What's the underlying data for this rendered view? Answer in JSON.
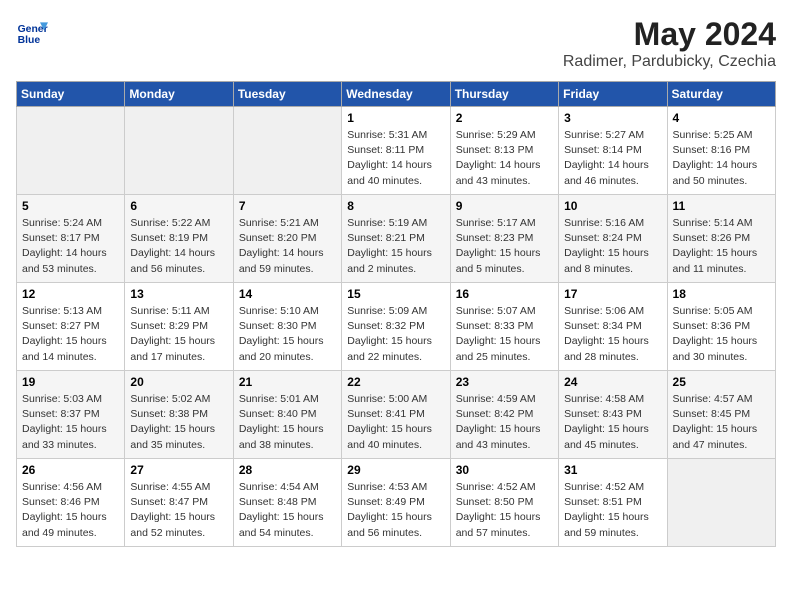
{
  "logo": {
    "line1": "General",
    "line2": "Blue"
  },
  "title": "May 2024",
  "subtitle": "Radimer, Pardubicky, Czechia",
  "headers": [
    "Sunday",
    "Monday",
    "Tuesday",
    "Wednesday",
    "Thursday",
    "Friday",
    "Saturday"
  ],
  "weeks": [
    [
      {
        "day": "",
        "info": ""
      },
      {
        "day": "",
        "info": ""
      },
      {
        "day": "",
        "info": ""
      },
      {
        "day": "1",
        "info": "Sunrise: 5:31 AM\nSunset: 8:11 PM\nDaylight: 14 hours\nand 40 minutes."
      },
      {
        "day": "2",
        "info": "Sunrise: 5:29 AM\nSunset: 8:13 PM\nDaylight: 14 hours\nand 43 minutes."
      },
      {
        "day": "3",
        "info": "Sunrise: 5:27 AM\nSunset: 8:14 PM\nDaylight: 14 hours\nand 46 minutes."
      },
      {
        "day": "4",
        "info": "Sunrise: 5:25 AM\nSunset: 8:16 PM\nDaylight: 14 hours\nand 50 minutes."
      }
    ],
    [
      {
        "day": "5",
        "info": "Sunrise: 5:24 AM\nSunset: 8:17 PM\nDaylight: 14 hours\nand 53 minutes."
      },
      {
        "day": "6",
        "info": "Sunrise: 5:22 AM\nSunset: 8:19 PM\nDaylight: 14 hours\nand 56 minutes."
      },
      {
        "day": "7",
        "info": "Sunrise: 5:21 AM\nSunset: 8:20 PM\nDaylight: 14 hours\nand 59 minutes."
      },
      {
        "day": "8",
        "info": "Sunrise: 5:19 AM\nSunset: 8:21 PM\nDaylight: 15 hours\nand 2 minutes."
      },
      {
        "day": "9",
        "info": "Sunrise: 5:17 AM\nSunset: 8:23 PM\nDaylight: 15 hours\nand 5 minutes."
      },
      {
        "day": "10",
        "info": "Sunrise: 5:16 AM\nSunset: 8:24 PM\nDaylight: 15 hours\nand 8 minutes."
      },
      {
        "day": "11",
        "info": "Sunrise: 5:14 AM\nSunset: 8:26 PM\nDaylight: 15 hours\nand 11 minutes."
      }
    ],
    [
      {
        "day": "12",
        "info": "Sunrise: 5:13 AM\nSunset: 8:27 PM\nDaylight: 15 hours\nand 14 minutes."
      },
      {
        "day": "13",
        "info": "Sunrise: 5:11 AM\nSunset: 8:29 PM\nDaylight: 15 hours\nand 17 minutes."
      },
      {
        "day": "14",
        "info": "Sunrise: 5:10 AM\nSunset: 8:30 PM\nDaylight: 15 hours\nand 20 minutes."
      },
      {
        "day": "15",
        "info": "Sunrise: 5:09 AM\nSunset: 8:32 PM\nDaylight: 15 hours\nand 22 minutes."
      },
      {
        "day": "16",
        "info": "Sunrise: 5:07 AM\nSunset: 8:33 PM\nDaylight: 15 hours\nand 25 minutes."
      },
      {
        "day": "17",
        "info": "Sunrise: 5:06 AM\nSunset: 8:34 PM\nDaylight: 15 hours\nand 28 minutes."
      },
      {
        "day": "18",
        "info": "Sunrise: 5:05 AM\nSunset: 8:36 PM\nDaylight: 15 hours\nand 30 minutes."
      }
    ],
    [
      {
        "day": "19",
        "info": "Sunrise: 5:03 AM\nSunset: 8:37 PM\nDaylight: 15 hours\nand 33 minutes."
      },
      {
        "day": "20",
        "info": "Sunrise: 5:02 AM\nSunset: 8:38 PM\nDaylight: 15 hours\nand 35 minutes."
      },
      {
        "day": "21",
        "info": "Sunrise: 5:01 AM\nSunset: 8:40 PM\nDaylight: 15 hours\nand 38 minutes."
      },
      {
        "day": "22",
        "info": "Sunrise: 5:00 AM\nSunset: 8:41 PM\nDaylight: 15 hours\nand 40 minutes."
      },
      {
        "day": "23",
        "info": "Sunrise: 4:59 AM\nSunset: 8:42 PM\nDaylight: 15 hours\nand 43 minutes."
      },
      {
        "day": "24",
        "info": "Sunrise: 4:58 AM\nSunset: 8:43 PM\nDaylight: 15 hours\nand 45 minutes."
      },
      {
        "day": "25",
        "info": "Sunrise: 4:57 AM\nSunset: 8:45 PM\nDaylight: 15 hours\nand 47 minutes."
      }
    ],
    [
      {
        "day": "26",
        "info": "Sunrise: 4:56 AM\nSunset: 8:46 PM\nDaylight: 15 hours\nand 49 minutes."
      },
      {
        "day": "27",
        "info": "Sunrise: 4:55 AM\nSunset: 8:47 PM\nDaylight: 15 hours\nand 52 minutes."
      },
      {
        "day": "28",
        "info": "Sunrise: 4:54 AM\nSunset: 8:48 PM\nDaylight: 15 hours\nand 54 minutes."
      },
      {
        "day": "29",
        "info": "Sunrise: 4:53 AM\nSunset: 8:49 PM\nDaylight: 15 hours\nand 56 minutes."
      },
      {
        "day": "30",
        "info": "Sunrise: 4:52 AM\nSunset: 8:50 PM\nDaylight: 15 hours\nand 57 minutes."
      },
      {
        "day": "31",
        "info": "Sunrise: 4:52 AM\nSunset: 8:51 PM\nDaylight: 15 hours\nand 59 minutes."
      },
      {
        "day": "",
        "info": ""
      }
    ]
  ]
}
